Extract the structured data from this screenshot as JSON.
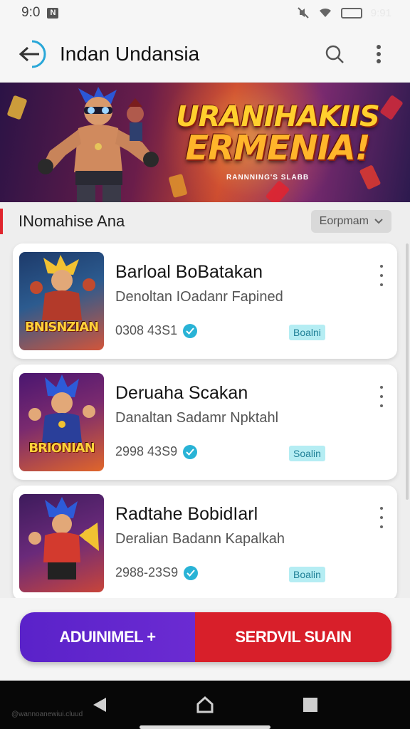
{
  "status_bar": {
    "time": "9:0",
    "right_text": "9:91"
  },
  "app_bar": {
    "title": "Indan Undansia",
    "back_icon": "arrow-left-icon",
    "search_icon": "search-icon",
    "menu_icon": "more-vert-icon"
  },
  "banner": {
    "title_line1": "URANIHAKIIS",
    "title_line2": "ERMENIA!",
    "subtitle": "RANNNING'S SLABB"
  },
  "section": {
    "title": "INomahise Ana",
    "sort_label": "Eorpmam"
  },
  "items": [
    {
      "title": "Barloal BoBatakan",
      "subtitle": "Denoltan IOadanr Fapined",
      "meta": "0308 43S1",
      "tag": "Boalni",
      "thumb_logo": "BNISNZIAN",
      "colors": [
        "#1d3a6a",
        "#d2553a"
      ]
    },
    {
      "title": "Deruaha Scakan",
      "subtitle": "Danaltan Sadamr Npktahl",
      "meta": "2998 43S9",
      "tag": "Soalin",
      "thumb_logo": "BRIONIAN",
      "colors": [
        "#4a1670",
        "#e0662a"
      ]
    },
    {
      "title": "Radtahe BobidIarl",
      "subtitle": "Deralian Badann Kapalkah",
      "meta": "2988-23S9",
      "tag": "Boalin",
      "thumb_logo": "",
      "colors": [
        "#3d1b5c",
        "#c8453a"
      ]
    }
  ],
  "bottom_actions": {
    "left_label": "ADUINIMEL +",
    "right_label": "SERDVIL SUAIN",
    "left_color": "#5a22c9",
    "right_color": "#d81f2a"
  },
  "nav": {
    "back": "triangle-back-icon",
    "home": "home-icon",
    "recent": "square-recent-icon"
  },
  "watermark": "@wannoanewiui.cluud"
}
